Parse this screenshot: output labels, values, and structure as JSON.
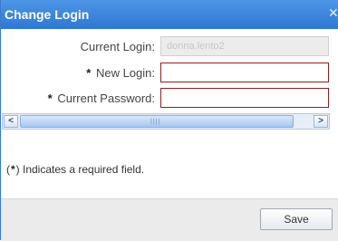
{
  "dialog": {
    "title": "Change Login",
    "close_glyph": "✕"
  },
  "form": {
    "required_marker": "*",
    "current_login": {
      "label": "Current Login:",
      "value": "donna.lento2"
    },
    "new_login": {
      "label": "New Login:",
      "value": ""
    },
    "current_password": {
      "label": "Current Password:",
      "value": ""
    }
  },
  "scrollbar": {
    "left_arrow": "<",
    "right_arrow": ">",
    "grip": "||||"
  },
  "note": {
    "open": "(",
    "close": ") Indicates a required field."
  },
  "footer": {
    "save_label": "Save"
  },
  "colors": {
    "titlebar": "#3b82dc",
    "required_border": "#8e1f1f"
  }
}
